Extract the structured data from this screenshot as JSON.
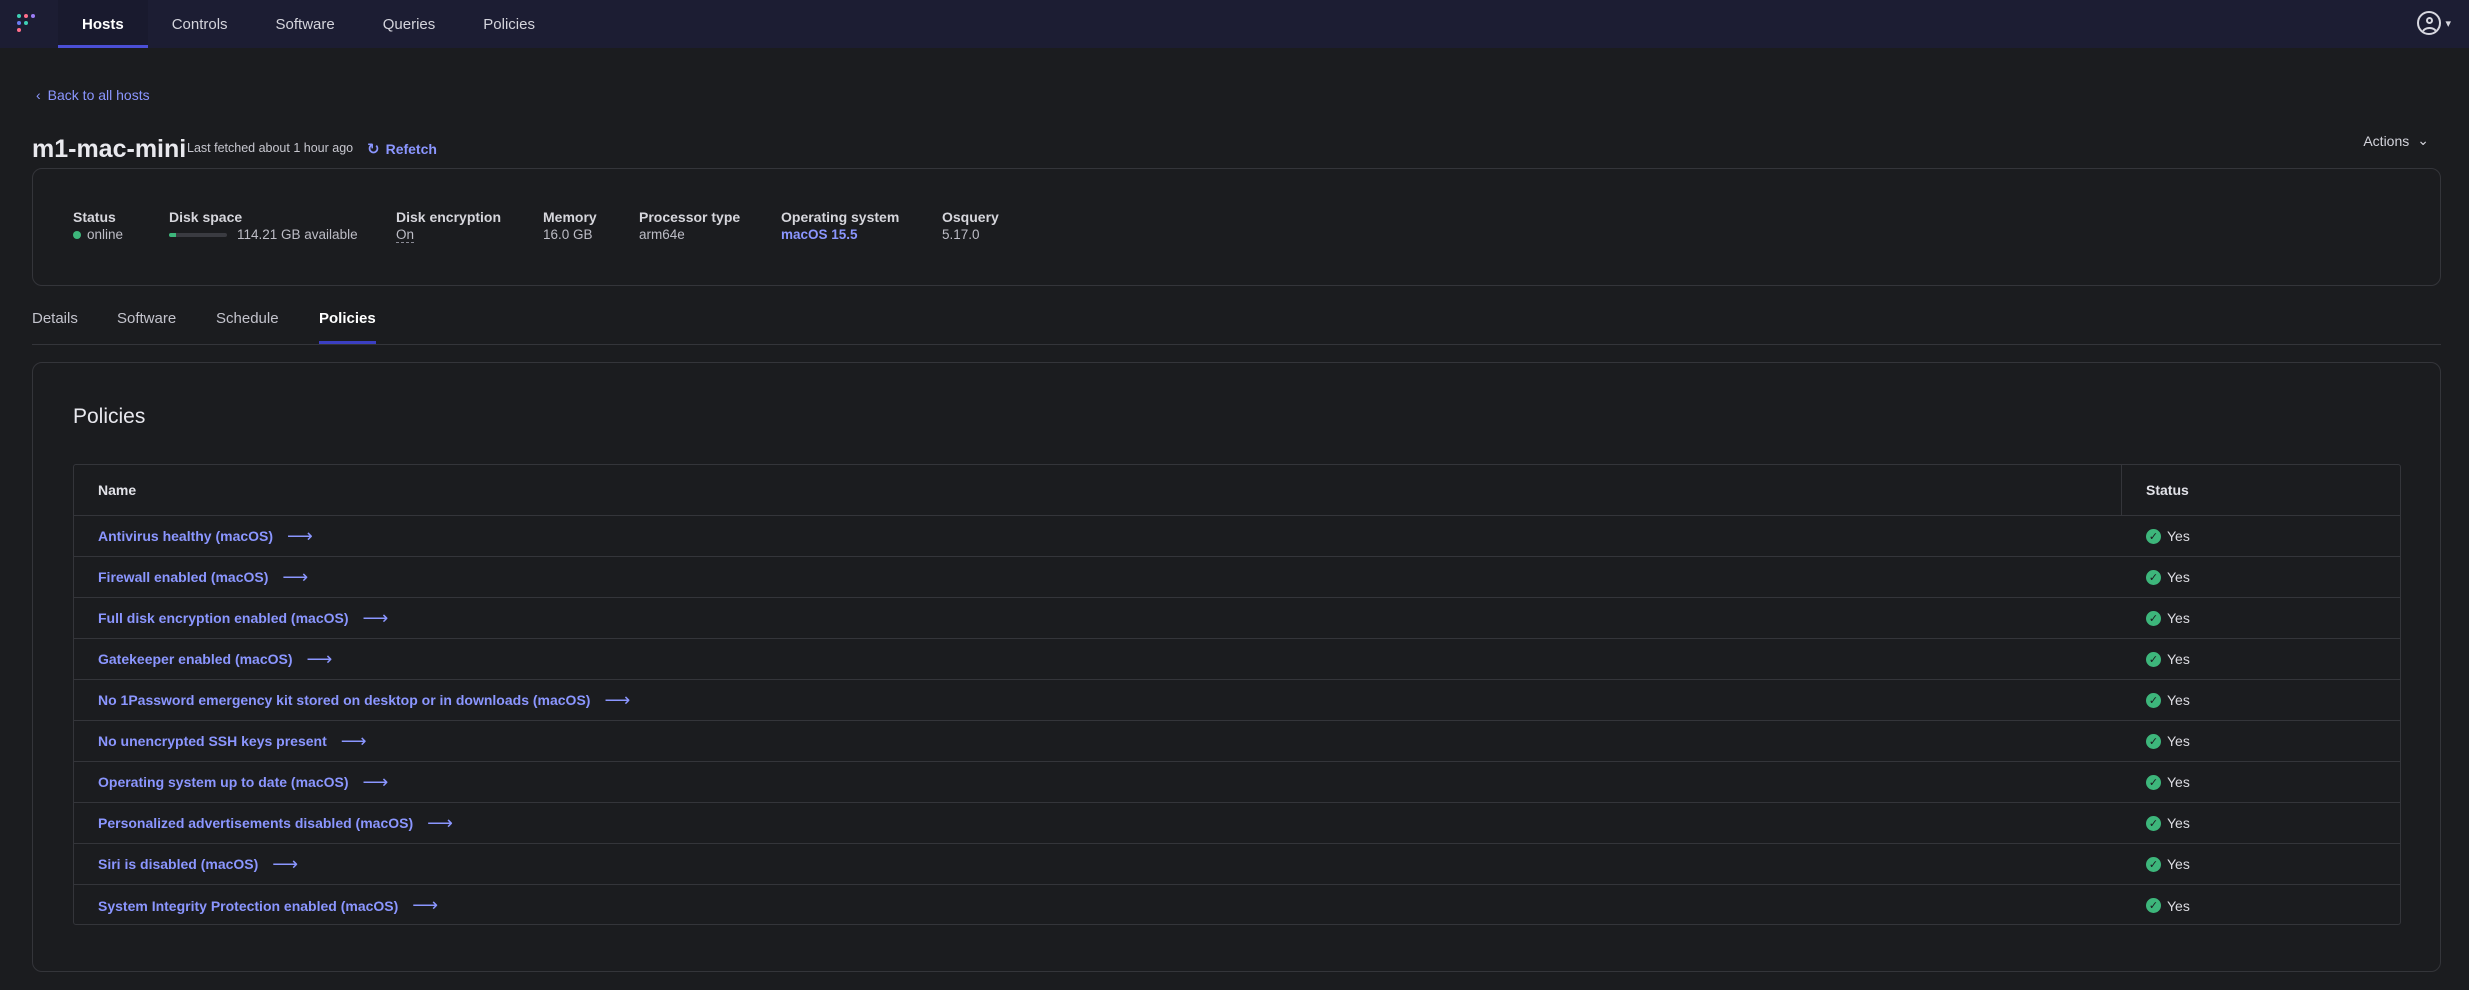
{
  "nav": {
    "tabs": [
      {
        "label": "Hosts"
      },
      {
        "label": "Controls"
      },
      {
        "label": "Software"
      },
      {
        "label": "Queries"
      },
      {
        "label": "Policies"
      }
    ]
  },
  "back_label": "Back to all hosts",
  "host": {
    "name": "m1-mac-mini",
    "last_fetched": "Last fetched about 1 hour ago",
    "refetch_label": "Refetch",
    "actions_label": "Actions"
  },
  "summary": {
    "status": {
      "label": "Status",
      "value": "online"
    },
    "disk_space": {
      "label": "Disk space",
      "value": "114.21 GB available",
      "used_fraction": 0.12
    },
    "disk_encryption": {
      "label": "Disk encryption",
      "value": "On"
    },
    "memory": {
      "label": "Memory",
      "value": "16.0 GB"
    },
    "processor": {
      "label": "Processor type",
      "value": "arm64e"
    },
    "os": {
      "label": "Operating system",
      "value": "macOS 15.5"
    },
    "osquery": {
      "label": "Osquery",
      "value": "5.17.0"
    }
  },
  "subtabs": [
    {
      "label": "Details"
    },
    {
      "label": "Software"
    },
    {
      "label": "Schedule"
    },
    {
      "label": "Policies"
    }
  ],
  "policies": {
    "title": "Policies",
    "columns": {
      "name": "Name",
      "status": "Status"
    },
    "rows": [
      {
        "name": "Antivirus healthy (macOS)",
        "status": "Yes"
      },
      {
        "name": "Firewall enabled (macOS)",
        "status": "Yes"
      },
      {
        "name": "Full disk encryption enabled (macOS)",
        "status": "Yes"
      },
      {
        "name": "Gatekeeper enabled (macOS)",
        "status": "Yes"
      },
      {
        "name": "No 1Password emergency kit stored on desktop or in downloads (macOS)",
        "status": "Yes"
      },
      {
        "name": "No unencrypted SSH keys present",
        "status": "Yes"
      },
      {
        "name": "Operating system up to date (macOS)",
        "status": "Yes"
      },
      {
        "name": "Personalized advertisements disabled (macOS)",
        "status": "Yes"
      },
      {
        "name": "Siri is disabled (macOS)",
        "status": "Yes"
      },
      {
        "name": "System Integrity Protection enabled (macOS)",
        "status": "Yes"
      }
    ]
  },
  "colors": {
    "accent": "#8b96ff",
    "success": "#3db67b",
    "nav_bg": "#1c1d33"
  }
}
